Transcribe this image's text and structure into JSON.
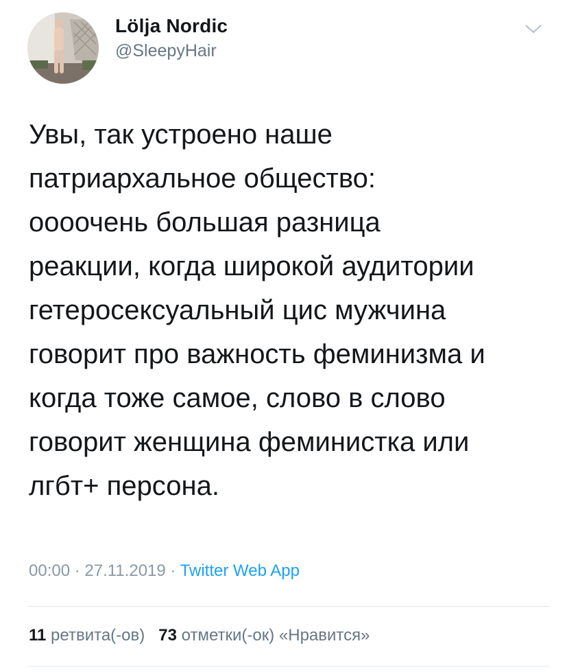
{
  "tweet": {
    "author": {
      "display_name": "Lölja Nordic",
      "handle": "@SleepyHair",
      "avatar_icon": "profile-photo"
    },
    "text": "Увы, так устроено наше\nпатриархальное общество:\nоооочень большая разница\nреакции, когда широкой аудитории\nгетеросексуальный цис мужчина\nговорит про важность феминизма и\nкогда тоже самое, слово в слово\nговорит женщина феминистка или\nлгбт+ персона.",
    "time": "00:00",
    "separator": "·",
    "date": "27.11.2019",
    "source": "Twitter Web App",
    "retweets": {
      "count": "11",
      "label": "ретвита(-ов)"
    },
    "likes": {
      "count": "73",
      "label": "отметки(-ок) «Нравится»"
    },
    "menu_icon": "chevron-down-icon"
  },
  "colors": {
    "text": "#14171a",
    "secondary": "#657786",
    "meta": "#8899a6",
    "link": "#1da1f2",
    "divider": "#e1e8ed"
  }
}
